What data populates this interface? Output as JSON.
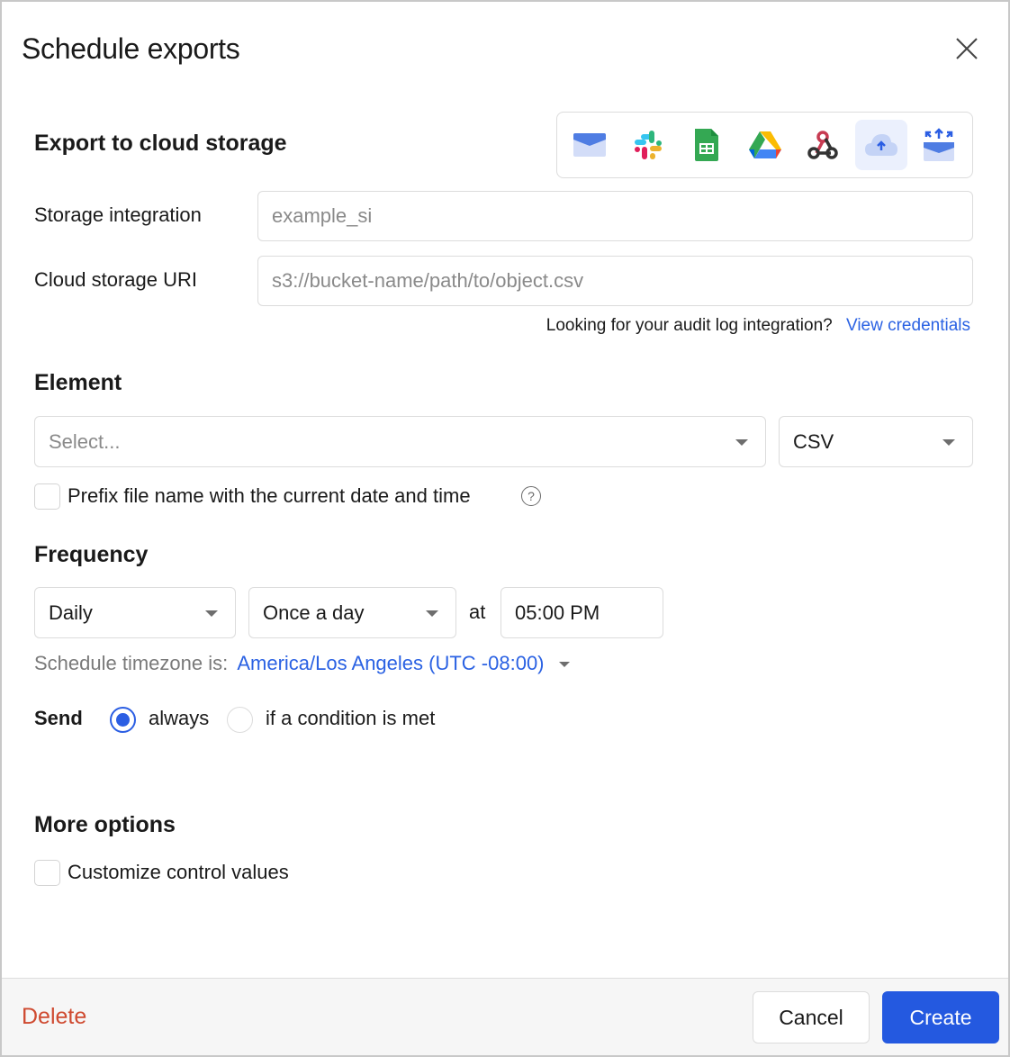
{
  "dialog": {
    "title": "Schedule exports",
    "close_icon": "close-icon"
  },
  "destination": {
    "heading": "Export to cloud storage",
    "icons": [
      {
        "name": "email-icon",
        "active": false
      },
      {
        "name": "slack-icon",
        "active": false
      },
      {
        "name": "google-sheets-icon",
        "active": false
      },
      {
        "name": "google-drive-icon",
        "active": false
      },
      {
        "name": "webhook-icon",
        "active": false
      },
      {
        "name": "cloud-upload-icon",
        "active": true
      },
      {
        "name": "export-tray-icon",
        "active": false
      }
    ],
    "storage_integration_label": "Storage integration",
    "storage_integration_placeholder": "example_si",
    "storage_integration_value": "",
    "uri_label": "Cloud storage URI",
    "uri_placeholder": "s3://bucket-name/path/to/object.csv",
    "uri_value": "",
    "audit_hint": "Looking for your audit log integration?",
    "audit_link": "View credentials"
  },
  "element": {
    "heading": "Element",
    "select_placeholder": "Select...",
    "format_value": "CSV",
    "prefix_checkbox_label": "Prefix file name with the current date and time",
    "prefix_checked": false,
    "help_glyph": "?"
  },
  "frequency": {
    "heading": "Frequency",
    "period_value": "Daily",
    "times_value": "Once a day",
    "at_label": "at",
    "time_value": "05:00 PM",
    "timezone_label": "Schedule timezone is:",
    "timezone_value": "America/Los Angeles (UTC -08:00)"
  },
  "send": {
    "label": "Send",
    "options": [
      {
        "label": "always",
        "selected": true
      },
      {
        "label": "if a condition is met",
        "selected": false
      }
    ]
  },
  "more_options": {
    "heading": "More options",
    "customize_label": "Customize control values",
    "customize_checked": false
  },
  "footer": {
    "delete_label": "Delete",
    "cancel_label": "Cancel",
    "create_label": "Create"
  },
  "colors": {
    "accent": "#2459e0",
    "link": "#2b62e3",
    "danger": "#cf4a30"
  }
}
